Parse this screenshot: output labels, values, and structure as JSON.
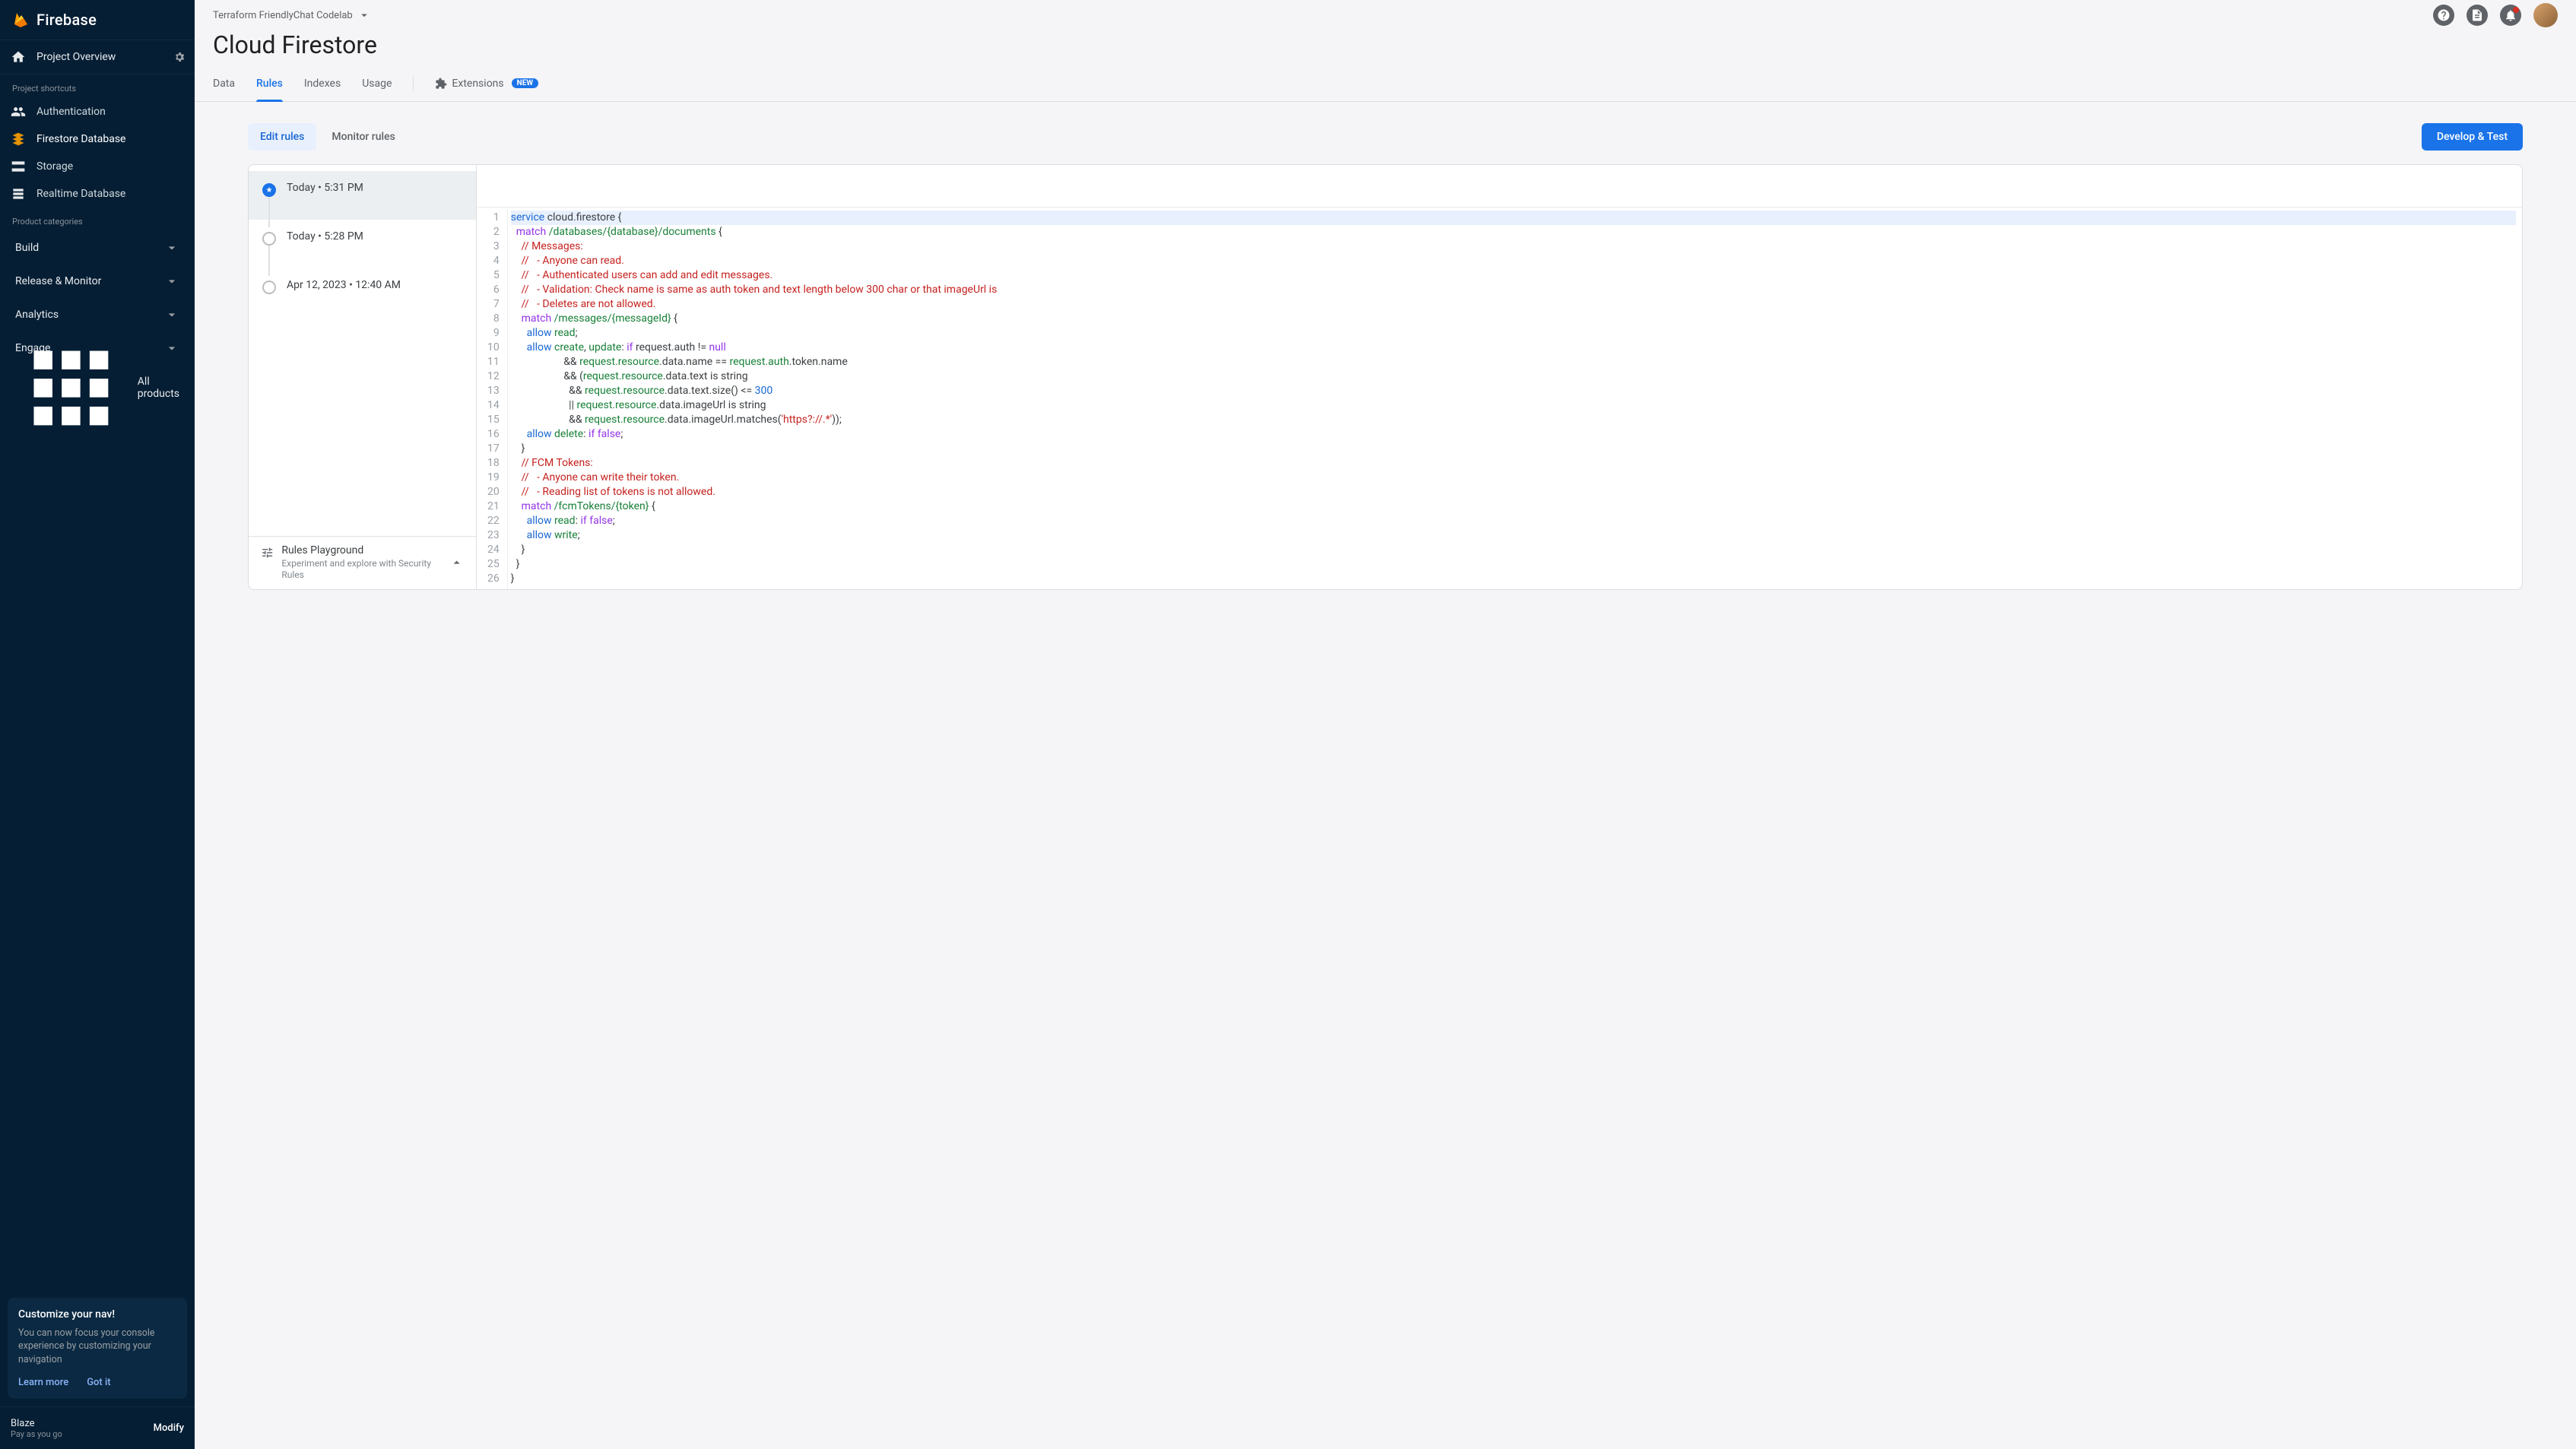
{
  "brand": "Firebase",
  "project_name": "Terraform FriendlyChat Codelab",
  "page_title": "Cloud Firestore",
  "overview_label": "Project Overview",
  "shortcuts_label": "Project shortcuts",
  "categories_label": "Product categories",
  "shortcuts": [
    {
      "label": "Authentication",
      "icon": "authentication-icon"
    },
    {
      "label": "Firestore Database",
      "icon": "firestore-icon",
      "active": true
    },
    {
      "label": "Storage",
      "icon": "storage-icon"
    },
    {
      "label": "Realtime Database",
      "icon": "realtime-db-icon"
    }
  ],
  "categories": [
    {
      "label": "Build"
    },
    {
      "label": "Release & Monitor"
    },
    {
      "label": "Analytics"
    },
    {
      "label": "Engage"
    }
  ],
  "all_products_label": "All products",
  "nav_card": {
    "title": "Customize your nav!",
    "body": "You can now focus your console experience by customizing your navigation",
    "learn_more": "Learn more",
    "got_it": "Got it"
  },
  "plan": {
    "name": "Blaze",
    "sub": "Pay as you go",
    "modify": "Modify"
  },
  "tabs": [
    {
      "label": "Data"
    },
    {
      "label": "Rules",
      "active": true
    },
    {
      "label": "Indexes"
    },
    {
      "label": "Usage"
    }
  ],
  "extensions_label": "Extensions",
  "extensions_badge": "NEW",
  "rules_subtabs": {
    "edit": "Edit rules",
    "monitor": "Monitor rules"
  },
  "dev_test_label": "Develop & Test",
  "history": [
    {
      "label": "Today • 5:31 PM",
      "selected": true
    },
    {
      "label": "Today • 5:28 PM"
    },
    {
      "label": "Apr 12, 2023 • 12:40 AM"
    }
  ],
  "playground": {
    "title": "Rules Playground",
    "sub": "Experiment and explore with Security Rules"
  },
  "code_lines": [
    [
      [
        "kw",
        "service"
      ],
      [
        "plain",
        " cloud.firestore {"
      ]
    ],
    [
      [
        "plain",
        "  "
      ],
      [
        "kw2",
        "match"
      ],
      [
        "plain",
        " "
      ],
      [
        "path",
        "/databases/{database}/documents"
      ],
      [
        "plain",
        " {"
      ]
    ],
    [
      [
        "plain",
        "    "
      ],
      [
        "cmt",
        "// Messages:"
      ]
    ],
    [
      [
        "plain",
        "    "
      ],
      [
        "cmt",
        "//   - Anyone can read."
      ]
    ],
    [
      [
        "plain",
        "    "
      ],
      [
        "cmt",
        "//   - Authenticated users can add and edit messages."
      ]
    ],
    [
      [
        "plain",
        "    "
      ],
      [
        "cmt",
        "//   - Validation: Check name is same as auth token and text length below 300 char or that imageUrl is"
      ]
    ],
    [
      [
        "plain",
        "    "
      ],
      [
        "cmt",
        "//   - Deletes are not allowed."
      ]
    ],
    [
      [
        "plain",
        "    "
      ],
      [
        "kw2",
        "match"
      ],
      [
        "plain",
        " "
      ],
      [
        "path",
        "/messages/{messageId}"
      ],
      [
        "plain",
        " {"
      ]
    ],
    [
      [
        "plain",
        "      "
      ],
      [
        "allow",
        "allow"
      ],
      [
        "plain",
        " "
      ],
      [
        "action",
        "read"
      ],
      [
        "plain",
        ";"
      ]
    ],
    [
      [
        "plain",
        "      "
      ],
      [
        "allow",
        "allow"
      ],
      [
        "plain",
        " "
      ],
      [
        "action",
        "create"
      ],
      [
        "plain",
        ", "
      ],
      [
        "action",
        "update"
      ],
      [
        "plain",
        ": "
      ],
      [
        "kw2",
        "if"
      ],
      [
        "plain",
        " request.auth != "
      ],
      [
        "null",
        "null"
      ]
    ],
    [
      [
        "plain",
        "                    && "
      ],
      [
        "req",
        "request.resource"
      ],
      [
        "plain",
        ".data.name == "
      ],
      [
        "req",
        "request.auth"
      ],
      [
        "plain",
        ".token.name"
      ]
    ],
    [
      [
        "plain",
        "                    && ("
      ],
      [
        "req",
        "request.resource"
      ],
      [
        "plain",
        ".data.text is string"
      ]
    ],
    [
      [
        "plain",
        "                      && "
      ],
      [
        "req",
        "request.resource"
      ],
      [
        "plain",
        ".data.text.size() <= "
      ],
      [
        "num",
        "300"
      ]
    ],
    [
      [
        "plain",
        "                      || "
      ],
      [
        "req",
        "request.resource"
      ],
      [
        "plain",
        ".data.imageUrl is string"
      ]
    ],
    [
      [
        "plain",
        "                      && "
      ],
      [
        "req",
        "request.resource"
      ],
      [
        "plain",
        ".data.imageUrl.matches("
      ],
      [
        "str",
        "'https?://.*'"
      ],
      [
        "plain",
        "));"
      ]
    ],
    [
      [
        "plain",
        "      "
      ],
      [
        "allow",
        "allow"
      ],
      [
        "plain",
        " "
      ],
      [
        "action",
        "delete"
      ],
      [
        "plain",
        ": "
      ],
      [
        "kw2",
        "if"
      ],
      [
        "plain",
        " "
      ],
      [
        "null",
        "false"
      ],
      [
        "plain",
        ";"
      ]
    ],
    [
      [
        "plain",
        "    }"
      ]
    ],
    [
      [
        "plain",
        "    "
      ],
      [
        "cmt",
        "// FCM Tokens:"
      ]
    ],
    [
      [
        "plain",
        "    "
      ],
      [
        "cmt",
        "//   - Anyone can write their token."
      ]
    ],
    [
      [
        "plain",
        "    "
      ],
      [
        "cmt",
        "//   - Reading list of tokens is not allowed."
      ]
    ],
    [
      [
        "plain",
        "    "
      ],
      [
        "kw2",
        "match"
      ],
      [
        "plain",
        " "
      ],
      [
        "path",
        "/fcmTokens/{token}"
      ],
      [
        "plain",
        " {"
      ]
    ],
    [
      [
        "plain",
        "      "
      ],
      [
        "allow",
        "allow"
      ],
      [
        "plain",
        " "
      ],
      [
        "action",
        "read"
      ],
      [
        "plain",
        ": "
      ],
      [
        "kw2",
        "if"
      ],
      [
        "plain",
        " "
      ],
      [
        "null",
        "false"
      ],
      [
        "plain",
        ";"
      ]
    ],
    [
      [
        "plain",
        "      "
      ],
      [
        "allow",
        "allow"
      ],
      [
        "plain",
        " "
      ],
      [
        "action",
        "write"
      ],
      [
        "plain",
        ";"
      ]
    ],
    [
      [
        "plain",
        "    }"
      ]
    ],
    [
      [
        "plain",
        "  }"
      ]
    ],
    [
      [
        "plain",
        "}"
      ]
    ]
  ]
}
